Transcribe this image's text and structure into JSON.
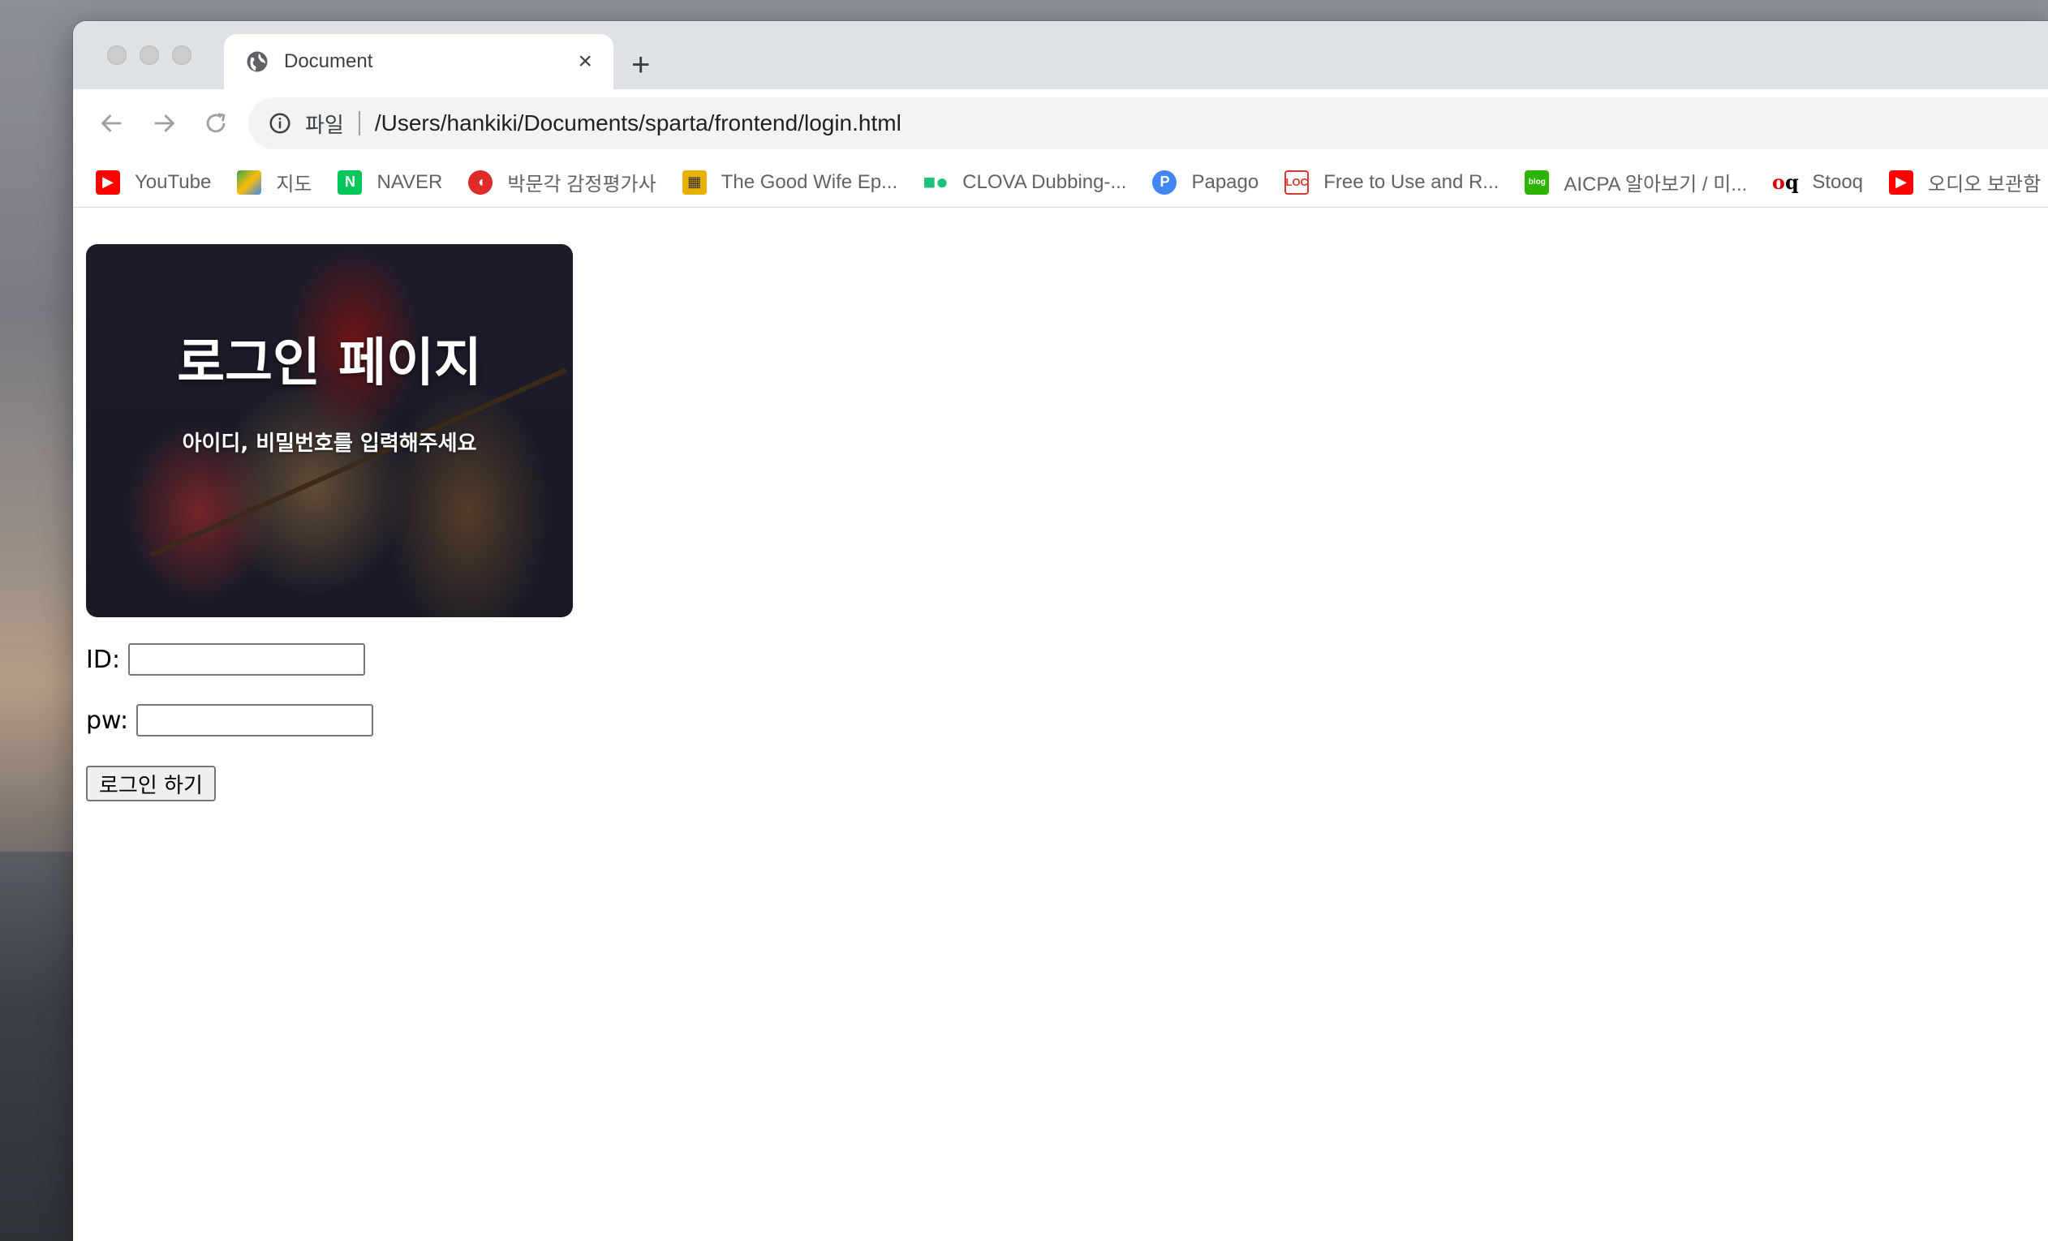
{
  "tab": {
    "title": "Document",
    "close": "×",
    "new": "+"
  },
  "omnibox": {
    "scheme": "파일",
    "url": "/Users/hankiki/Documents/sparta/frontend/login.html"
  },
  "bookmarks": [
    {
      "label": "YouTube",
      "icon": "youtube-icon",
      "color": "#ff0000"
    },
    {
      "label": "지도",
      "icon": "maps-icon",
      "color": "#34a853"
    },
    {
      "label": "NAVER",
      "icon": "naver-icon",
      "color": "#03c75a"
    },
    {
      "label": "박문각 감정평가사",
      "icon": "pmg-icon",
      "color": "#e02b2b"
    },
    {
      "label": "The Good Wife Ep...",
      "icon": "goodwife-icon",
      "color": "#e8b100"
    },
    {
      "label": "CLOVA Dubbing-...",
      "icon": "clova-icon",
      "color": "#1ec27a"
    },
    {
      "label": "Papago",
      "icon": "papago-icon",
      "color": "#4285f4"
    },
    {
      "label": "Free to Use and R...",
      "icon": "loc-icon",
      "color": "#d63a2f"
    },
    {
      "label": "AICPA 알아보기 / 미...",
      "icon": "blog-icon",
      "color": "#2db400"
    },
    {
      "label": "Stooq",
      "icon": "stooq-icon",
      "color": "#000000"
    },
    {
      "label": "오디오 보관함",
      "icon": "youtube-icon",
      "color": "#ff0000"
    }
  ],
  "hero": {
    "title": "로그인 페이지",
    "subtitle": "아이디, 비밀번호를 입력해주세요"
  },
  "form": {
    "id_label": "ID:",
    "id_value": "",
    "pw_label": "pw:",
    "pw_value": "",
    "submit": "로그인 하기"
  }
}
